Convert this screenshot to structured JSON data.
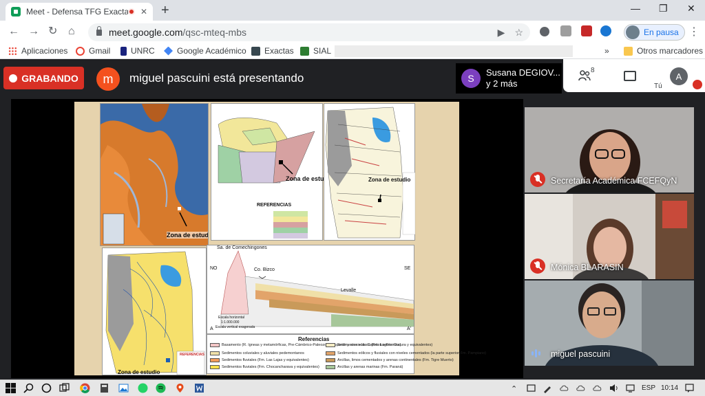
{
  "browser": {
    "tab_title": "Meet - Defensa TFG Exactas",
    "tab_close": "✕",
    "new_tab": "+",
    "window_controls": {
      "minimize": "—",
      "restore": "❐",
      "close": "✕"
    },
    "nav": {
      "back": "←",
      "forward": "→",
      "reload": "↻",
      "home": "⌂"
    },
    "url_host": "meet.google.com",
    "url_path": "/qsc-mteq-mbs",
    "omnibox_icons": {
      "camera": "▶",
      "star": "☆"
    },
    "profile_status": "En pausa",
    "menu": "⋮",
    "bookmarks": [
      {
        "label": "Aplicaciones",
        "icon": "apps-grid-icon",
        "color": "#4285f4"
      },
      {
        "label": "Gmail",
        "icon": "google-icon",
        "color": "#ea4335"
      },
      {
        "label": "UNRC",
        "icon": "unrc-icon",
        "color": "#1a237e"
      },
      {
        "label": "Google Académico",
        "icon": "scholar-icon",
        "color": "#4285f4"
      },
      {
        "label": "Exactas",
        "icon": "exactas-icon",
        "color": "#37474f"
      },
      {
        "label": "SIAL",
        "icon": "sial-icon",
        "color": "#2e7d32"
      }
    ],
    "bookmarks_overflow": "»",
    "other_bookmarks": "Otros marcadores"
  },
  "meet": {
    "recording_label": "GRABANDO",
    "presenter_initial": "m",
    "presenter_color": "#f4511e",
    "presenting_text": "miguel pascuini está presentando",
    "others_initial": "S",
    "others_line1": "Susana DEGIOV...",
    "others_line2": "y 2 más",
    "participant_count": "8",
    "self_initial": "A",
    "self_label": "Tú",
    "slide": {
      "map1_label": "Zona de estudio",
      "map2_label": "Zona de estudi",
      "map2_legend_title": "REFERENCIAS",
      "map3_label": "Zona de estudio",
      "map4_label": "Zona de estudio",
      "map4_legend_title": "REFERENCIAS",
      "section_top_label": "Sa. de Comechingones",
      "section_no": "NO",
      "section_se": "SE",
      "section_mid": "Co. Bizco",
      "section_right_town": "Levalle",
      "section_a": "A",
      "section_a_prime": "A'",
      "scale_line1": "Escala horizontal",
      "scale_line2": "1:1.000.000",
      "scale_line3": "Escala vertical exagerada",
      "legend_title": "Referencias",
      "legend_left": [
        {
          "text": "Basamento (R. ígneas y metamórficas, Pre-Cámbrico-Paleozoico superior y areniscas Carbónico-Pérmica)",
          "color": "#f3c6c6"
        },
        {
          "text": "Sedimentos coluviales y aluviales pedemontanos",
          "color": "#f0e0a8"
        },
        {
          "text": "Sedimentos fluviales (Fm. Las Lajas y equivalentes)",
          "color": "#f39c5b"
        },
        {
          "text": "Sedimentos fluviales (Fm. Chocancharava y equivalentes)",
          "color": "#f7e04a"
        }
      ],
      "legend_right": [
        {
          "text": "Sedimentos eólicos (Fm. Laguna Oscura y equivalentes)",
          "color": "#f6ecc4"
        },
        {
          "text": "Sedimentos eólicos y fluviales con niveles cementados (la parte superior Fm. Pampiano)",
          "color": "#e2a46a"
        },
        {
          "text": "Arcillas, limos cementados y arenas continentales (Fm. Tigre Muerto)",
          "color": "#c99a5a"
        },
        {
          "text": "Arcillas y arenas marinas (Fm. Paraná)",
          "color": "#a7c79a"
        }
      ]
    },
    "participants": [
      {
        "name": "Secretaría Académica FCEFQyN",
        "muted": true
      },
      {
        "name": "Mónica BLARASIN",
        "muted": true
      },
      {
        "name": "miguel pascuini",
        "muted": false
      }
    ]
  },
  "taskbar": {
    "tray_lang": "ESP",
    "time": "10:14"
  }
}
